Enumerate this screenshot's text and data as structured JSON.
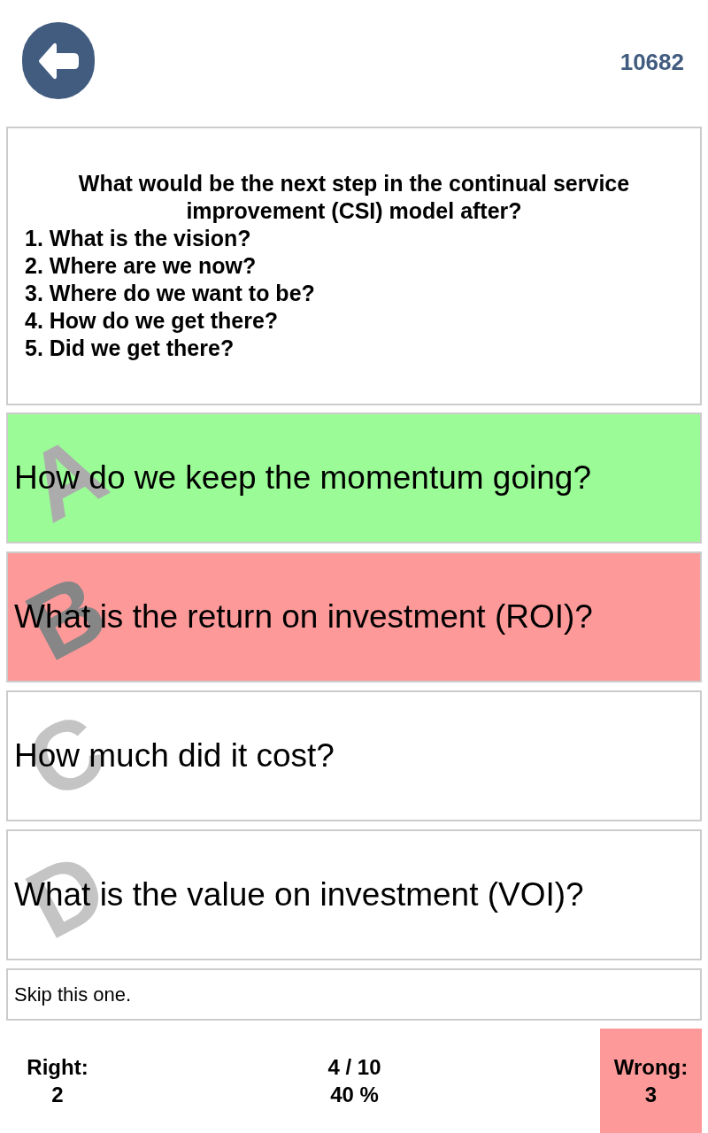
{
  "header": {
    "score": "10682"
  },
  "question": {
    "title": "What would be the next step in the continual service improvement (CSI) model after?",
    "steps": [
      "1. What is the vision?",
      "2. Where are we now?",
      "3. Where do we want to be?",
      "4. How do we get there?",
      "5. Did we get there?"
    ]
  },
  "answers": [
    {
      "letter": "A",
      "text": "How do we keep the momentum going?",
      "correct": true,
      "selected": false
    },
    {
      "letter": "B",
      "text": "What is the return on investment (ROI)?",
      "correct": false,
      "selected": true
    },
    {
      "letter": "C",
      "text": "How much did it cost?",
      "correct": false,
      "selected": false
    },
    {
      "letter": "D",
      "text": "What is the value on investment (VOI)?",
      "correct": false,
      "selected": false
    }
  ],
  "skip": {
    "label": "Skip this one."
  },
  "footer": {
    "right": {
      "label": "Right:",
      "value": "2",
      "highlighted": false
    },
    "progress": {
      "count": "4 / 10",
      "percent": "40 %"
    },
    "wrong": {
      "label": "Wrong:",
      "value": "3",
      "highlighted": true
    }
  }
}
